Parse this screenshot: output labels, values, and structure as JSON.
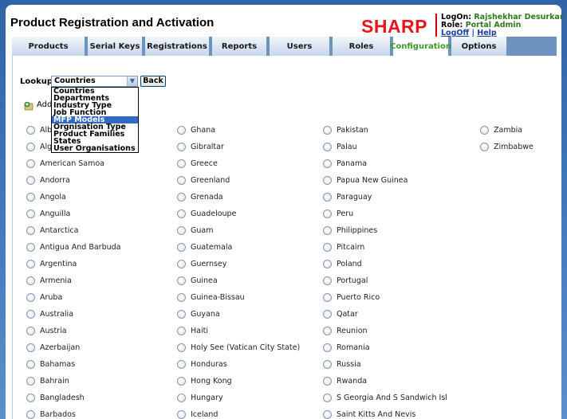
{
  "app": {
    "title": "Product Registration and Activation",
    "logo": "SHARP"
  },
  "user": {
    "logon_label": "LogOn:",
    "logon_name": "Rajshekhar Desurkar",
    "role_label": "Role:",
    "role_name": "Portal Admin",
    "logoff": "LogOff",
    "separator": "|",
    "help": "Help"
  },
  "tabs": [
    {
      "label": "Products"
    },
    {
      "label": "Serial Keys"
    },
    {
      "label": "Registrations"
    },
    {
      "label": "Reports"
    },
    {
      "label": "Users"
    },
    {
      "label": "Roles"
    },
    {
      "label": "Configuration",
      "active": true
    },
    {
      "label": "Options"
    }
  ],
  "lookup": {
    "label": "Lookup",
    "selected": "Countries",
    "back_label": "Back",
    "options": [
      "Countries",
      "Departments",
      "Industry Type",
      "Job Function",
      "MFP Models",
      "Orgnisation Type",
      "Product Families",
      "States",
      "User Organisations"
    ],
    "highlighted": "MFP Models"
  },
  "add_label": "Add",
  "countries": {
    "col1": [
      "Albania",
      "Algeria",
      "American Samoa",
      "Andorra",
      "Angola",
      "Anguilla",
      "Antarctica",
      "Antigua And Barbuda",
      "Argentina",
      "Armenia",
      "Aruba",
      "Australia",
      "Austria",
      "Azerbaijan",
      "Bahamas",
      "Bahrain",
      "Bangladesh",
      "Barbados"
    ],
    "col2": [
      "Ghana",
      "Gibraltar",
      "Greece",
      "Greenland",
      "Grenada",
      "Guadeloupe",
      "Guam",
      "Guatemala",
      "Guernsey",
      "Guinea",
      "Guinea-Bissau",
      "Guyana",
      "Haiti",
      "Holy See (Vatican City State)",
      "Honduras",
      "Hong Kong",
      "Hungary",
      "Iceland"
    ],
    "col3": [
      "Pakistan",
      "Palau",
      "Panama",
      "Papua New Guinea",
      "Paraguay",
      "Peru",
      "Philippines",
      "Pitcairn",
      "Poland",
      "Portugal",
      "Puerto Rico",
      "Qatar",
      "Reunion",
      "Romania",
      "Russia",
      "Rwanda",
      "S Georgia And S Sandwich Isl",
      "Saint Kitts And Nevis"
    ],
    "col4": [
      "Zambia",
      "Zimbabwe"
    ]
  },
  "colors": {
    "tab_active_text": "#3a9a27",
    "logo": "#e8141c",
    "highlight": "#316ac5"
  }
}
